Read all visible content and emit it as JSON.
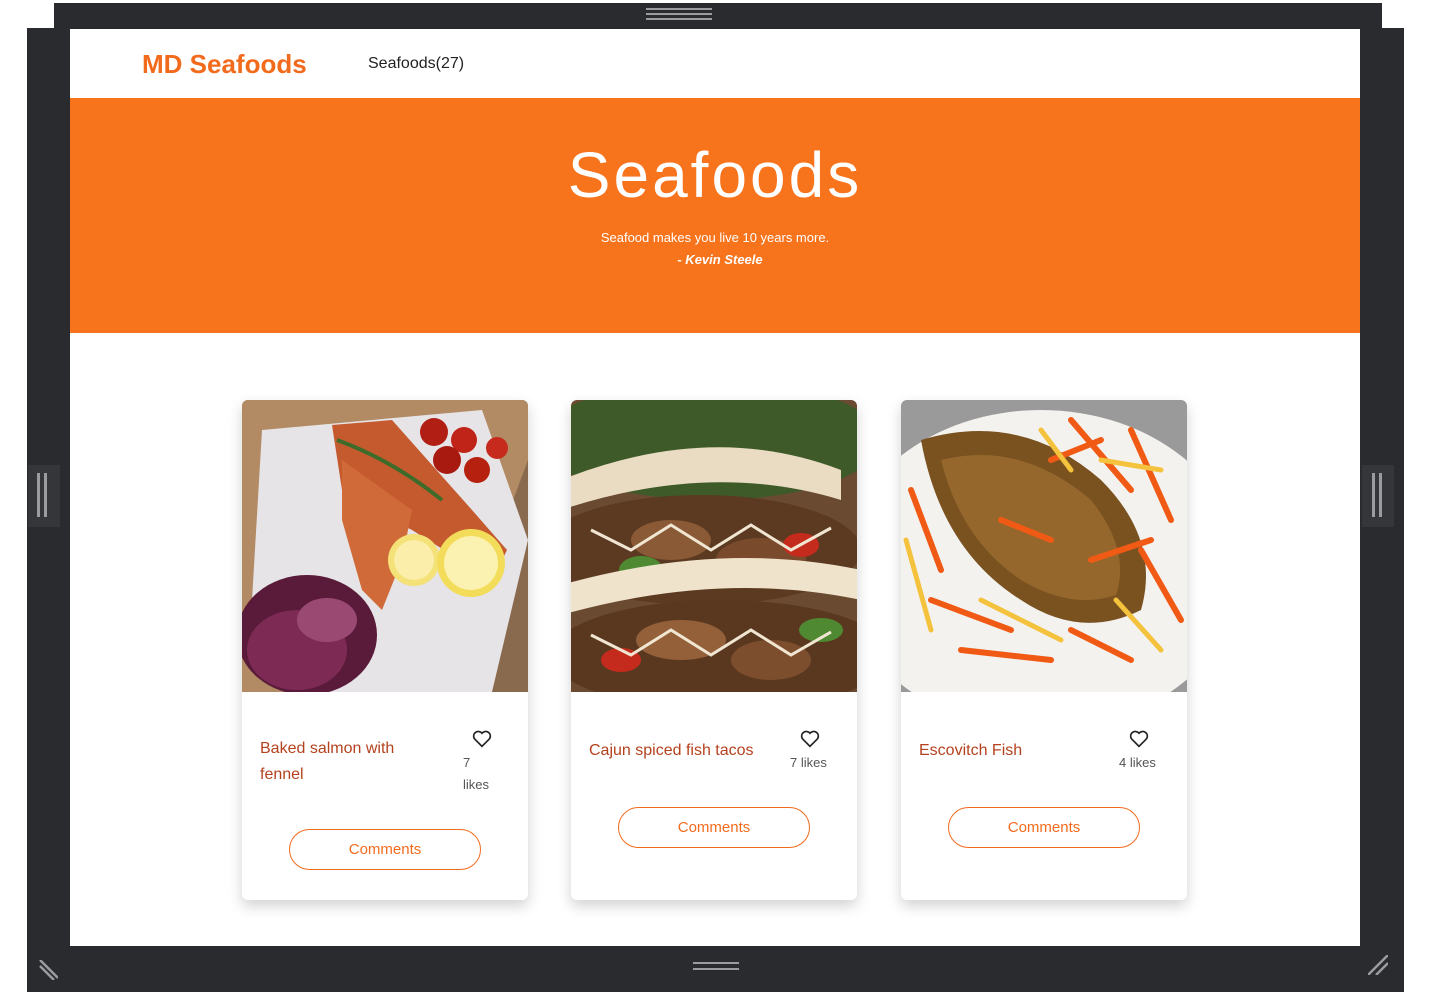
{
  "nav": {
    "brand": "MD Seafoods",
    "link": "Seafoods(27)"
  },
  "hero": {
    "title": "Seafoods",
    "quote": "Seafood makes you live 10 years more.",
    "author": "- Kevin Steele"
  },
  "cards": [
    {
      "title": "Baked salmon with fennel",
      "likes_count": "7",
      "likes_label": "likes",
      "button": "Comments"
    },
    {
      "title": "Cajun spiced fish tacos",
      "likes": "7 likes",
      "button": "Comments"
    },
    {
      "title": "Escovitch Fish",
      "likes": "4 likes",
      "button": "Comments"
    }
  ],
  "colors": {
    "accent": "#f7731c",
    "brand": "#f26b1d",
    "title_text": "#b5421e",
    "frame": "#2a2b2e"
  }
}
